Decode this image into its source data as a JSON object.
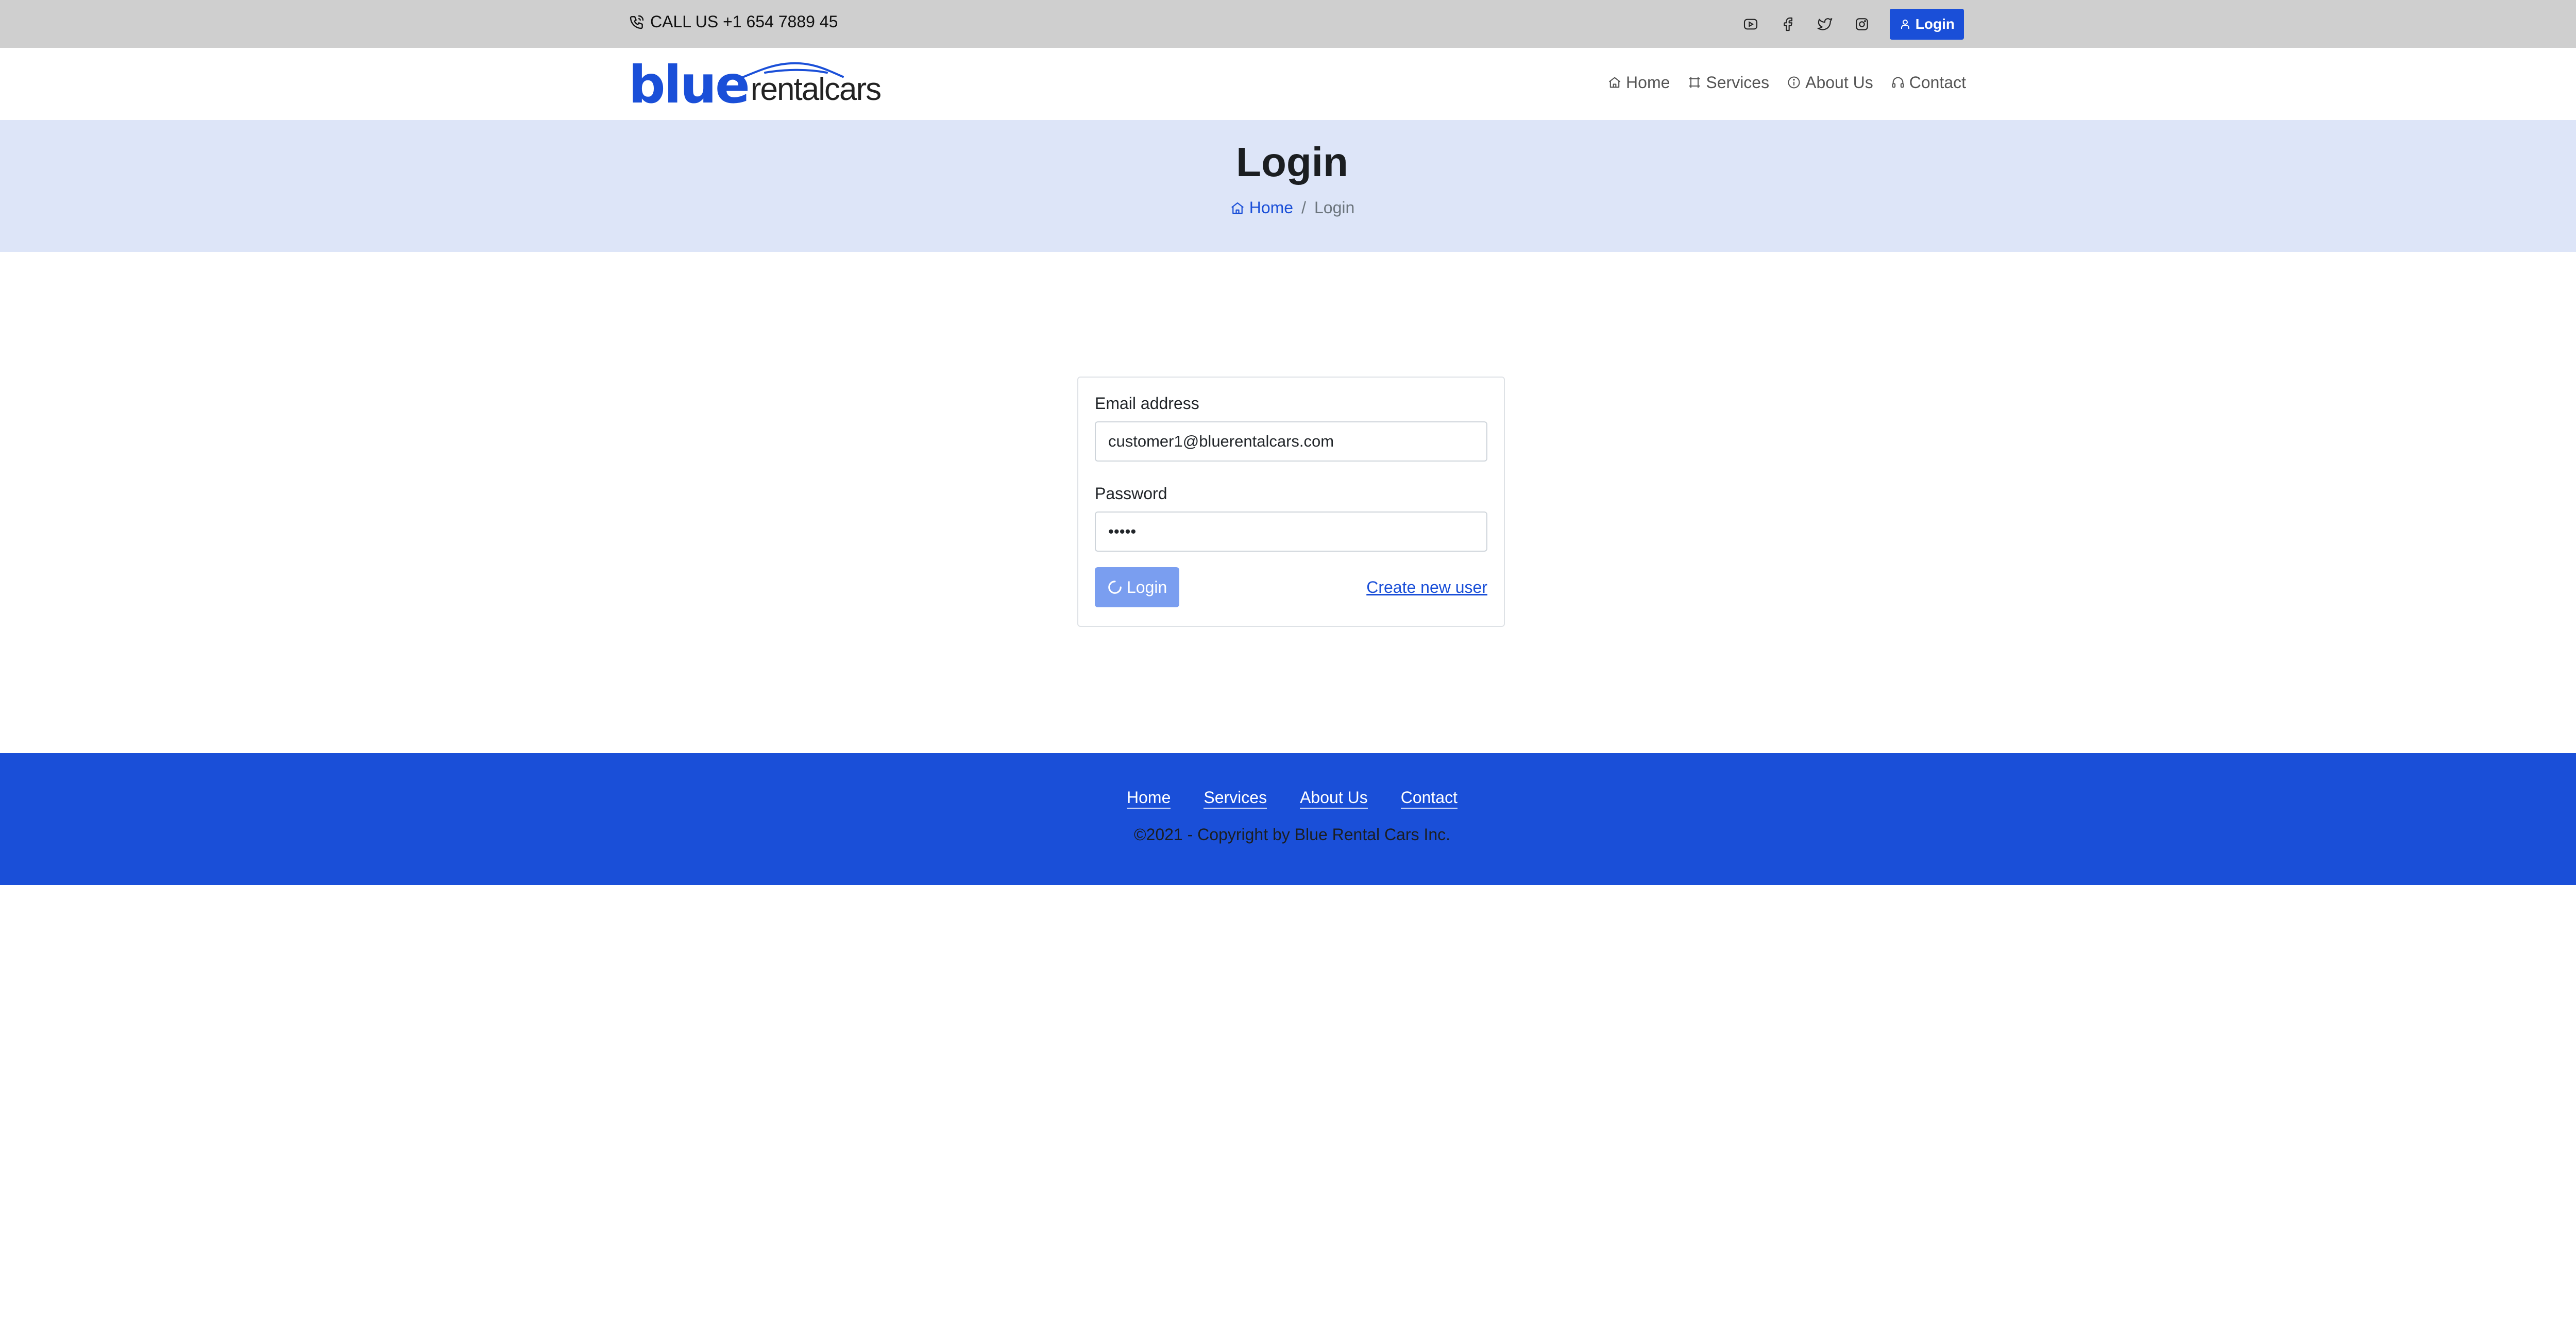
{
  "topbar": {
    "call_text": "CALL US +1 654 7889 45",
    "social": [
      "youtube-icon",
      "facebook-icon",
      "twitter-icon",
      "instagram-icon"
    ],
    "login_label": "Login"
  },
  "brand": {
    "blue": "blue",
    "rental": "rentalcars"
  },
  "nav": {
    "home": "Home",
    "services": "Services",
    "about": "About Us",
    "contact": "Contact"
  },
  "hero": {
    "title": "Login",
    "breadcrumb_home": "Home",
    "breadcrumb_sep": "/",
    "breadcrumb_current": "Login"
  },
  "form": {
    "email_label": "Email address",
    "email_value": "customer1@bluerentalcars.com",
    "password_label": "Password",
    "password_value": "12345",
    "login_button": "Login",
    "create_link": "Create new user"
  },
  "footer": {
    "links": [
      "Home",
      "Services",
      "About Us",
      "Contact"
    ],
    "copyright": "©2021 - Copyright by Blue Rental Cars Inc."
  },
  "colors": {
    "primary": "#1a4fd8",
    "topbar": "#cfcfcf",
    "hero": "#dde5f8",
    "button_disabled": "#7a9ef0"
  }
}
